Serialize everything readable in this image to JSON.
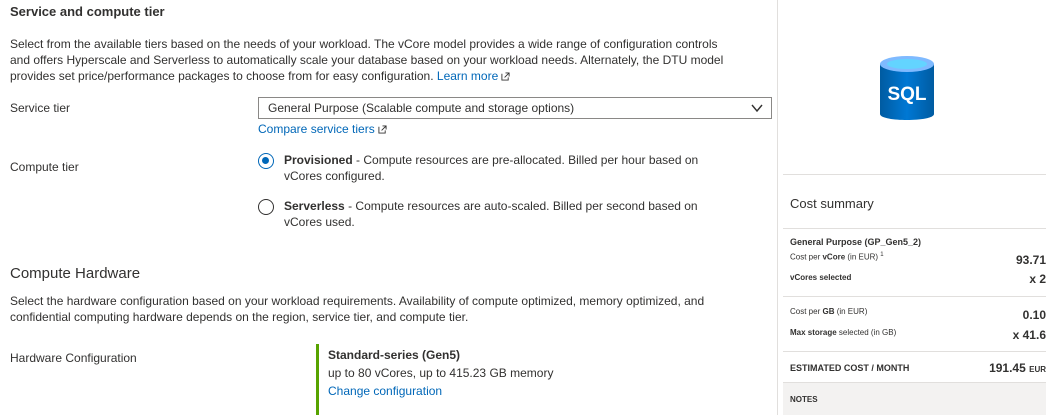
{
  "service_section": {
    "title": "Service and compute tier",
    "description_line1": "Select from the available tiers based on the needs of your workload. The vCore model provides a wide range of configuration controls",
    "description_line2": "and offers Hyperscale and Serverless to automatically scale your database based on your workload needs. Alternately, the DTU model",
    "description_line3": "provides set price/performance packages to choose from for easy configuration.",
    "learn_more": "Learn more",
    "service_tier_label": "Service tier",
    "service_tier_value": "General Purpose (Scalable compute and storage options)",
    "compare_link": "Compare service tiers",
    "compute_tier_label": "Compute tier",
    "provisioned_title": "Provisioned",
    "provisioned_desc_line1": " - Compute resources are pre-allocated. Billed per hour based on",
    "provisioned_desc_line2": "vCores configured.",
    "serverless_title": "Serverless",
    "serverless_desc_line1": " - Compute resources are auto-scaled. Billed per second based on",
    "serverless_desc_line2": "vCores used.",
    "selected_compute_tier": "Provisioned"
  },
  "hardware_section": {
    "title": "Compute Hardware",
    "description_line1": "Select the hardware configuration based on your workload requirements. Availability of compute optimized, memory optimized, and",
    "description_line2": "confidential computing hardware depends on the region, service tier, and compute tier.",
    "config_label": "Hardware Configuration",
    "config_name": "Standard-series (Gen5)",
    "config_desc": "up to 80 vCores, up to 415.23 GB memory",
    "change_link": "Change configuration"
  },
  "cost_summary": {
    "icon_text": "SQL",
    "title": "Cost summary",
    "tier_name": "General Purpose (GP_Gen5_2)",
    "cost_per_vcore_prefix": "Cost per ",
    "cost_per_vcore_bold": "vCore",
    "cost_per_vcore_suffix": " (in EUR) ",
    "footnote": "1",
    "cost_per_vcore_value": "93.71",
    "vcores_label": "vCores selected",
    "vcores_value": "x 2",
    "cost_per_gb_prefix": "Cost per ",
    "cost_per_gb_bold": "GB",
    "cost_per_gb_suffix": " (in EUR)",
    "cost_per_gb_value": "0.10",
    "max_storage_bold": "Max storage",
    "max_storage_suffix": " selected (in GB)",
    "max_storage_value": "x 41.6",
    "estimated_label": "ESTIMATED COST / MONTH",
    "estimated_value": "191.45",
    "estimated_currency": "EUR",
    "notes_label": "NOTES"
  },
  "colors": {
    "link": "#0067b8",
    "accent_green": "#57a300",
    "sql_blue": "#0078d4"
  }
}
